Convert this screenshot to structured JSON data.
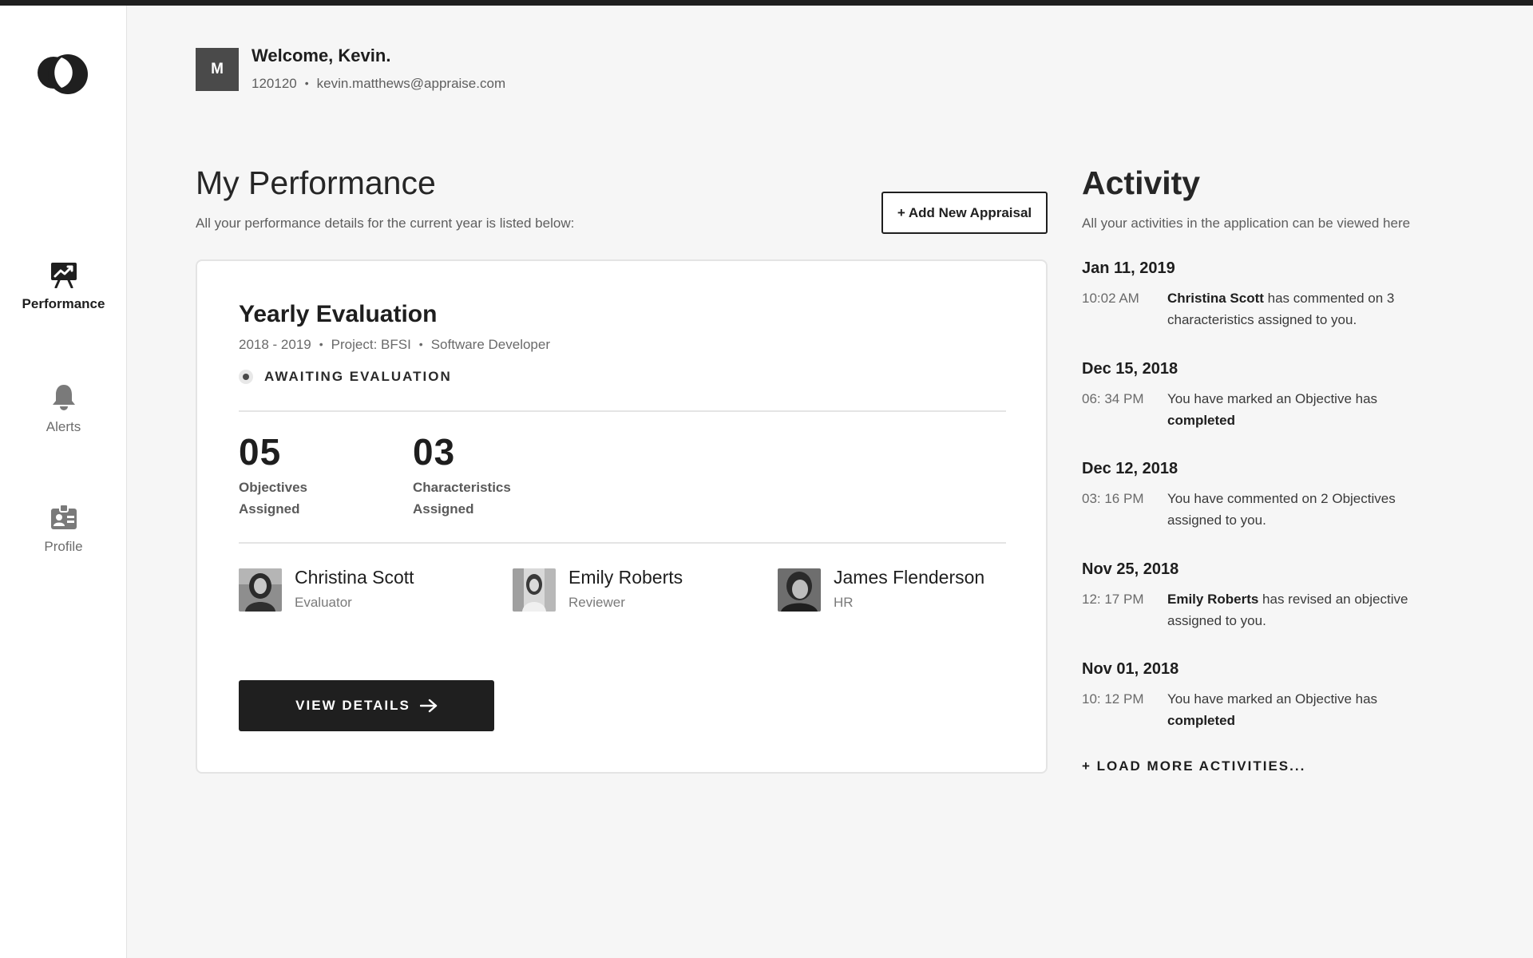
{
  "sidebar": {
    "items": [
      {
        "label": "Performance",
        "icon": "presentation-chart-icon",
        "active": true
      },
      {
        "label": "Alerts",
        "icon": "bell-icon",
        "active": false
      },
      {
        "label": "Profile",
        "icon": "id-badge-icon",
        "active": false
      }
    ]
  },
  "header": {
    "avatar_initial": "M",
    "welcome": "Welcome, Kevin.",
    "employee_id": "120120",
    "email": "kevin.matthews@appraise.com"
  },
  "performance": {
    "title": "My Performance",
    "subtitle": "All your performance details for the current year is listed below:",
    "add_button": "+ Add New Appraisal",
    "card": {
      "title": "Yearly Evaluation",
      "period": "2018 - 2019",
      "project": "Project: BFSI",
      "role": "Software Developer",
      "status": "AWAITING EVALUATION",
      "stats": [
        {
          "value": "05",
          "label_line1": "Objectives",
          "label_line2": "Assigned"
        },
        {
          "value": "03",
          "label_line1": "Characteristics",
          "label_line2": "Assigned"
        }
      ],
      "people": [
        {
          "name": "Christina Scott",
          "role": "Evaluator"
        },
        {
          "name": "Emily Roberts",
          "role": "Reviewer"
        },
        {
          "name": "James Flenderson",
          "role": "HR"
        }
      ],
      "view_button": "VIEW DETAILS"
    }
  },
  "activity": {
    "title": "Activity",
    "subtitle": "All your activities in the application can be viewed here",
    "items": [
      {
        "date": "Jan 11, 2019",
        "time": "10:02 AM",
        "bold": "Christina Scott",
        "text": " has commented on 3 characteristics assigned to you.",
        "bold_end": ""
      },
      {
        "date": "Dec 15, 2018",
        "time": "06: 34 PM",
        "bold": "",
        "text": "You have marked an Objective has ",
        "bold_end": "completed"
      },
      {
        "date": "Dec 12, 2018",
        "time": "03: 16 PM",
        "bold": "",
        "text": "You have commented on 2 Objectives assigned to you.",
        "bold_end": ""
      },
      {
        "date": "Nov 25, 2018",
        "time": "12: 17 PM",
        "bold": "Emily Roberts",
        "text": " has revised an objective assigned to you.",
        "bold_end": ""
      },
      {
        "date": "Nov 01, 2018",
        "time": "10: 12 PM",
        "bold": "",
        "text": "You have marked an Objective has ",
        "bold_end": "completed"
      }
    ],
    "load_more": "+ LOAD MORE ACTIVITIES..."
  }
}
